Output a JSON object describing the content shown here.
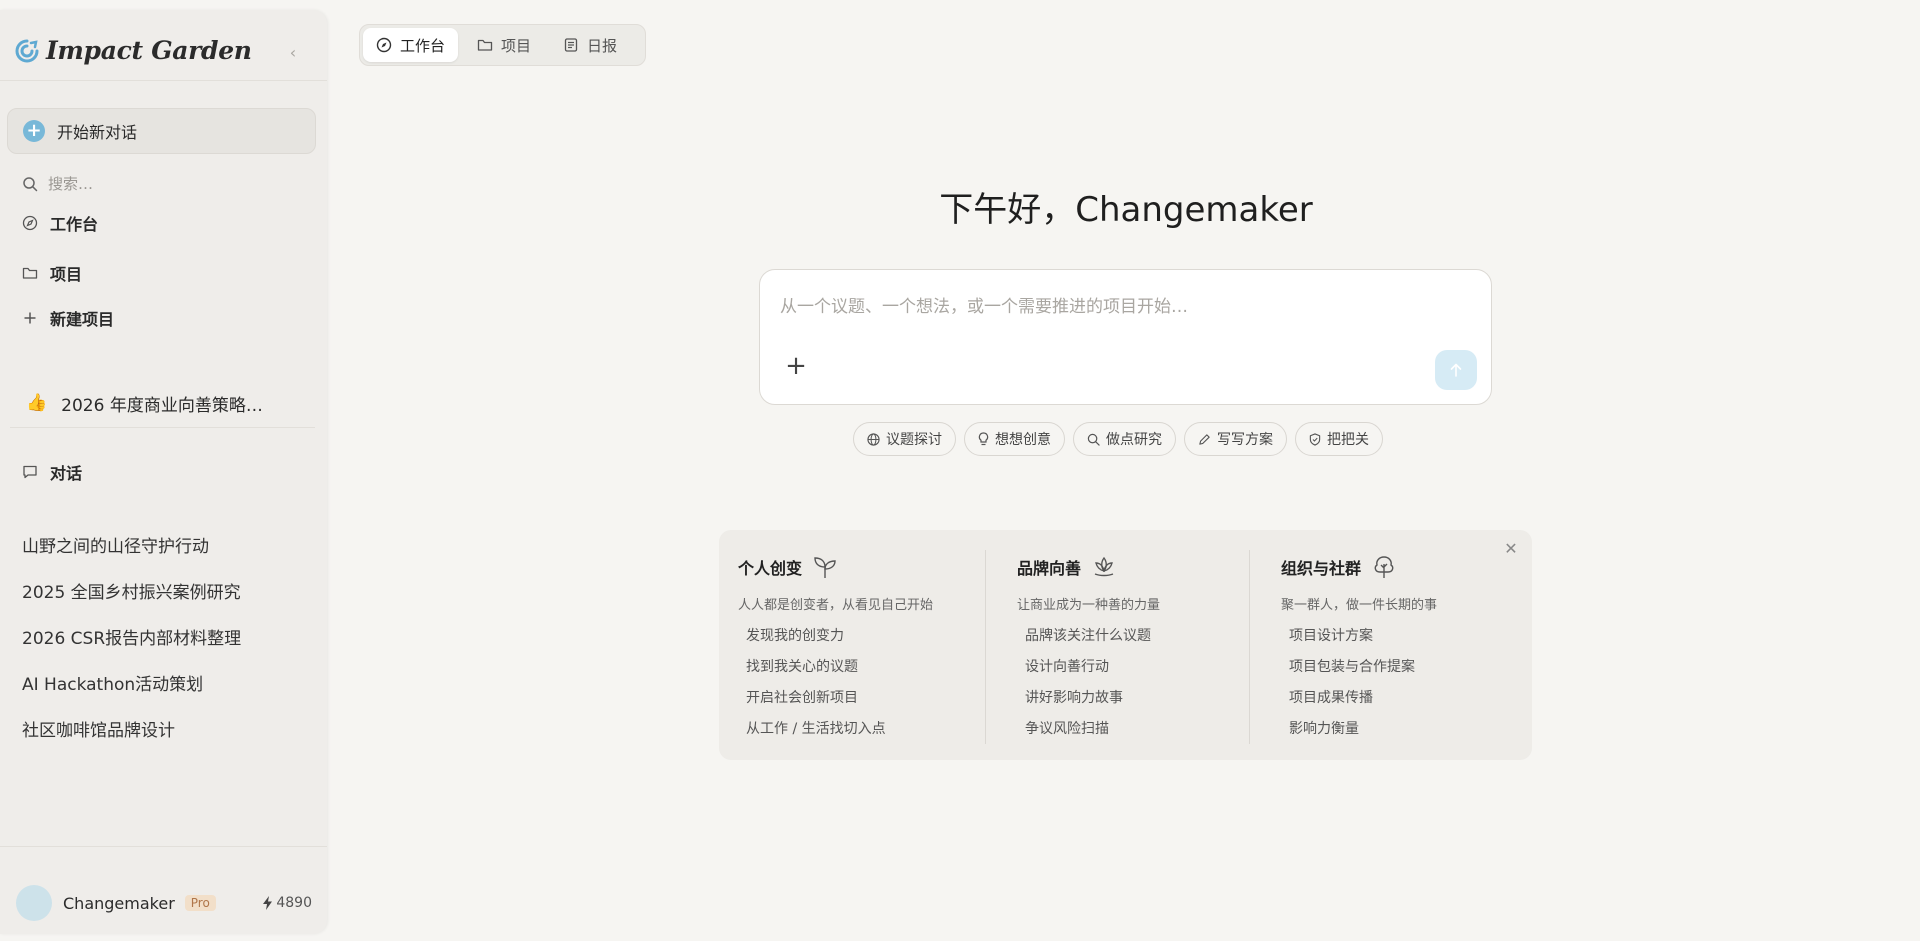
{
  "colors": {
    "accent": "#78b8d8",
    "send_button": "#d6ebf5",
    "pro_badge_bg": "#f2dfc9",
    "pro_badge_text": "#b0764a"
  },
  "sidebar": {
    "logo_text": "Impact Garden",
    "logo_icon": "swirl-logo-icon",
    "collapse_icon": "chevron-left-icon",
    "new_chat_label": "开始新对话",
    "search_placeholder": "搜索…",
    "nav": {
      "workspace": "工作台",
      "projects": "项目",
      "new_project": "新建项目"
    },
    "pinned_project": {
      "emoji": "👍",
      "label": "2026 年度商业向善策略…"
    },
    "conversations_header": "对话",
    "conversations": [
      "山野之间的山径守护行动",
      "2025 全国乡村振兴案例研究",
      "2026 CSR报告内部材料整理",
      "AI Hackathon活动策划",
      "社区咖啡馆品牌设计"
    ],
    "user": {
      "name": "Changemaker",
      "badge": "Pro",
      "credits": "4890"
    }
  },
  "tabs": [
    {
      "label": "工作台",
      "icon": "compass-icon",
      "active": true
    },
    {
      "label": "项目",
      "icon": "folder-icon",
      "active": false
    },
    {
      "label": "日报",
      "icon": "newspaper-icon",
      "active": false
    }
  ],
  "main": {
    "greeting": "下午好，Changemaker",
    "composer_placeholder": "从一个议题、一个想法，或一个需要推进的项目开始…",
    "chips": [
      {
        "label": "议题探讨",
        "icon": "globe-icon"
      },
      {
        "label": "想想创意",
        "icon": "lightbulb-icon"
      },
      {
        "label": "做点研究",
        "icon": "search-icon"
      },
      {
        "label": "写写方案",
        "icon": "pen-icon"
      },
      {
        "label": "把把关",
        "icon": "shield-icon"
      }
    ],
    "cards": [
      {
        "title": "个人创变",
        "icon": "sprout-icon",
        "subtitle": "人人都是创变者，从看见自己开始",
        "links": [
          "发现我的创变力",
          "找到我关心的议题",
          "开启社会创新项目",
          "从工作 / 生活找切入点"
        ]
      },
      {
        "title": "品牌向善",
        "icon": "lotus-icon",
        "subtitle": "让商业成为一种善的力量",
        "links": [
          "品牌该关注什么议题",
          "设计向善行动",
          "讲好影响力故事",
          "争议风险扫描"
        ]
      },
      {
        "title": "组织与社群",
        "icon": "tree-icon",
        "subtitle": "聚一群人，做一件长期的事",
        "links": [
          "项目设计方案",
          "项目包装与合作提案",
          "项目成果传播",
          "影响力衡量"
        ]
      }
    ]
  }
}
